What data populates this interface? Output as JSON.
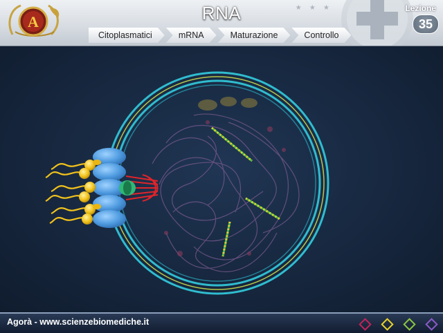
{
  "header": {
    "title": "RNA",
    "lesson_label": "Lezione",
    "lesson_number": "35",
    "logo_letter": "A",
    "tabs": [
      {
        "label": "Citoplasmatici"
      },
      {
        "label": "mRNA"
      },
      {
        "label": "Maturazione"
      },
      {
        "label": "Controllo"
      }
    ]
  },
  "footer": {
    "site_text": "Agorà - www.scienzebiomediche.it",
    "nav_buttons": [
      {
        "name": "nav-diamond-red",
        "color": "#c0245a"
      },
      {
        "name": "nav-diamond-yellow",
        "color": "#e8d22a"
      },
      {
        "name": "nav-diamond-green",
        "color": "#8cc63f"
      },
      {
        "name": "nav-diamond-purple",
        "color": "#8a5bc9"
      }
    ]
  },
  "colors": {
    "nucleus_ring": "#35c4d8",
    "pore_blue": "#5aa8e6",
    "pore_red": "#e0242a",
    "mrna_gold": "#f2c21b"
  }
}
